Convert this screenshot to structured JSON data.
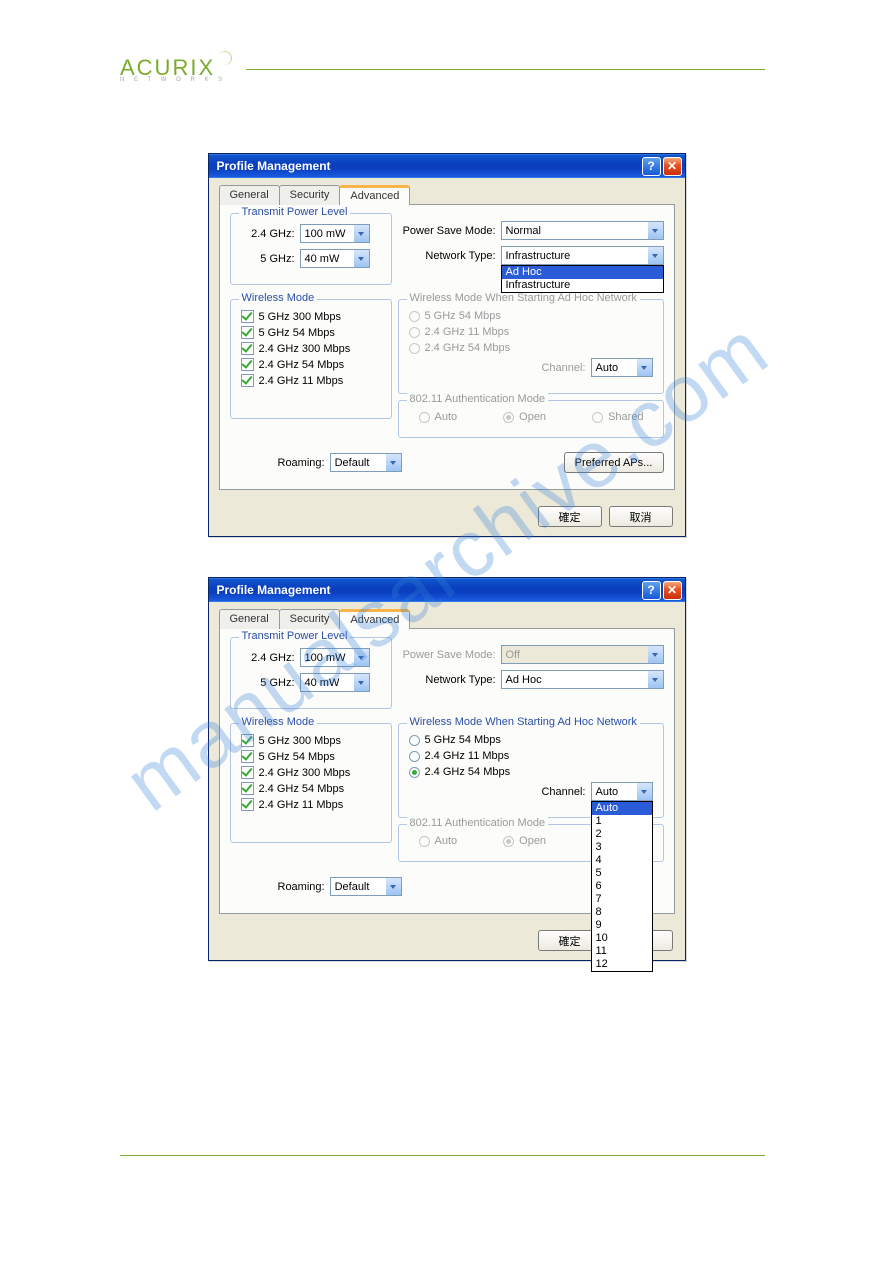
{
  "brand": {
    "name": "ACURIX",
    "sub": "N E T W O R K S"
  },
  "watermark": "manualsarchive.com",
  "dialog": {
    "title": "Profile Management",
    "tabs": {
      "general": "General",
      "security": "Security",
      "advanced": "Advanced"
    },
    "groups": {
      "transmit": "Transmit Power Level",
      "wireless_mode": "Wireless Mode",
      "wireless_start": "Wireless Mode When Starting Ad Hoc Network",
      "auth": "802.11 Authentication Mode"
    },
    "labels": {
      "g24": "2.4 GHz:",
      "g5": "5 GHz:",
      "power_save": "Power Save Mode:",
      "network_type": "Network Type:",
      "channel": "Channel:",
      "roaming": "Roaming:"
    },
    "wireless_modes": [
      "5 GHz 300 Mbps",
      "5 GHz 54 Mbps",
      "2.4 GHz 300 Mbps",
      "2.4 GHz 54 Mbps",
      "2.4 GHz 11 Mbps"
    ],
    "adhoc_modes": [
      "5 GHz 54 Mbps",
      "2.4 GHz 11 Mbps",
      "2.4 GHz 54 Mbps"
    ],
    "auth_options": {
      "auto": "Auto",
      "open": "Open",
      "shared": "Shared"
    },
    "buttons": {
      "preferred_aps": "Preferred APs...",
      "ok": "確定",
      "cancel": "取消"
    }
  },
  "top": {
    "power24": "100 mW",
    "power5": "40 mW",
    "power_save": "Normal",
    "network_type": "Infrastructure",
    "network_type_options": [
      "Ad Hoc",
      "Infrastructure"
    ],
    "channel": "Auto",
    "roaming": "Default"
  },
  "bottom": {
    "power24": "100 mW",
    "power5": "40 mW",
    "power_save": "Off",
    "network_type": "Ad Hoc",
    "channel": "Auto",
    "channel_options": [
      "Auto",
      "1",
      "2",
      "3",
      "4",
      "5",
      "6",
      "7",
      "8",
      "9",
      "10",
      "11",
      "12"
    ],
    "roaming": "Default"
  }
}
